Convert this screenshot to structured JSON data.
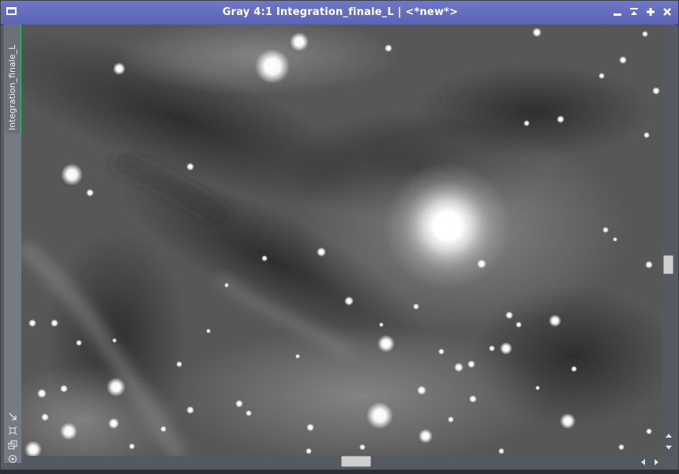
{
  "window": {
    "title": "Gray 4:1 Integration_finale_L | <*new*>",
    "icons": {
      "app": "window-icon",
      "minimize": "minimize-icon",
      "shade": "shade-icon",
      "maximize": "maximize-icon",
      "close": "close-icon"
    },
    "colors": {
      "titlebar": "#5f69b9",
      "active_tab": "#27c46a",
      "frame": "#575b63"
    }
  },
  "sidebar": {
    "tab_label": "Integration_finale_L",
    "tools": [
      "fit-view-icon",
      "crosshair-icon",
      "clone-icon",
      "target-icon"
    ]
  },
  "scrollbars": {
    "vertical": {
      "position": 0.55,
      "arrows": [
        "up-arrow-icon",
        "down-arrow-icon"
      ]
    },
    "horizontal": {
      "position": 0.5,
      "arrows": [
        "left-arrow-icon",
        "right-arrow-icon"
      ]
    }
  },
  "image": {
    "type": "grayscale astrophoto",
    "content": "star field with nebulosity"
  }
}
